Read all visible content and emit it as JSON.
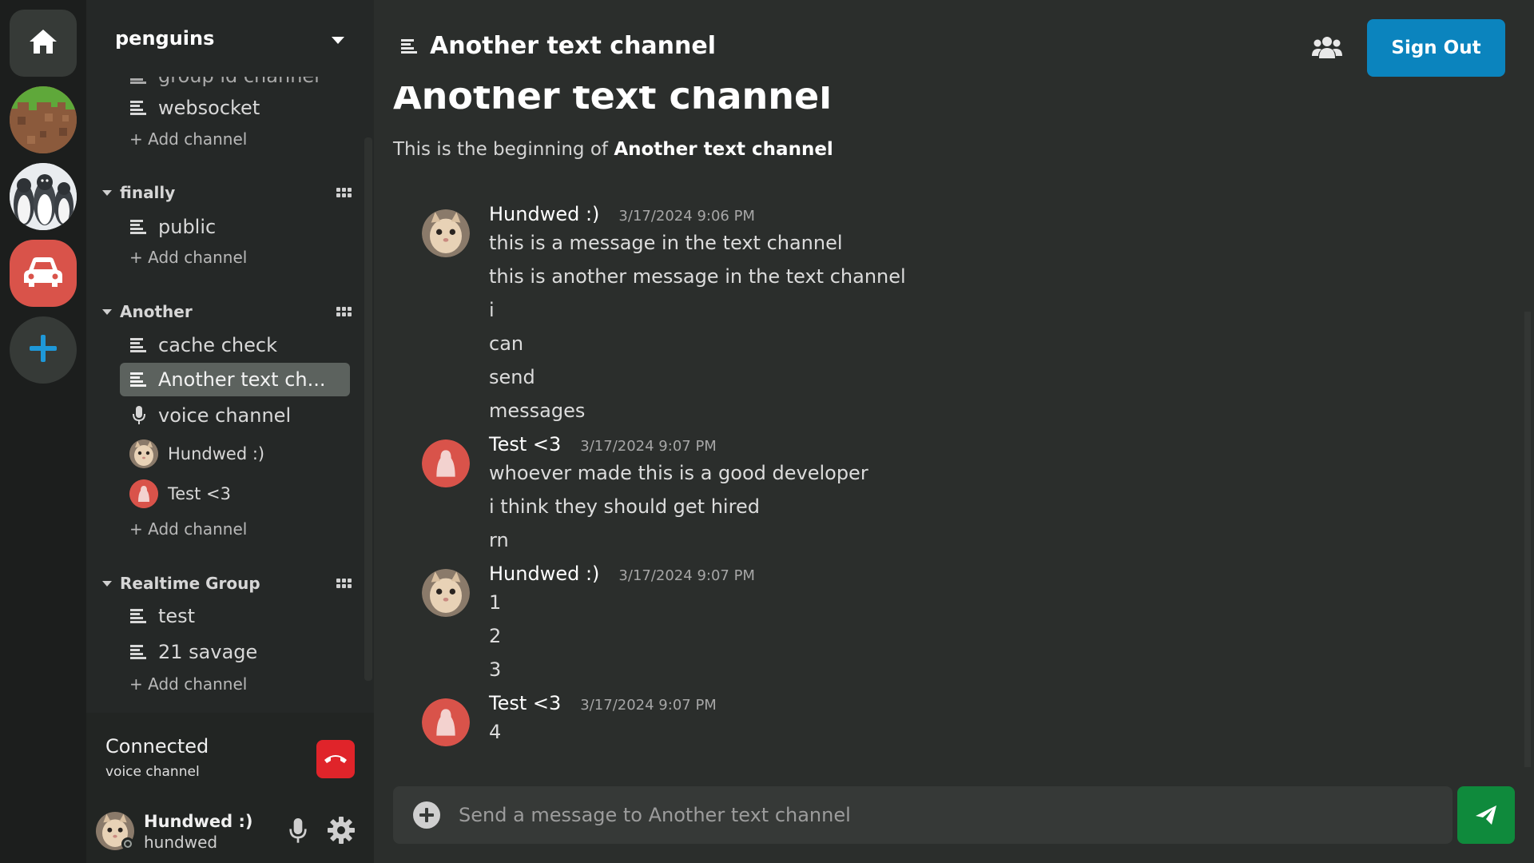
{
  "server": {
    "name": "penguins"
  },
  "sidebar": {
    "clipped_channel": "group id channel",
    "top_channels": [
      {
        "label": "websocket"
      }
    ],
    "add_channel_label": "+ Add channel",
    "categories": [
      {
        "name": "finally",
        "channels": [
          {
            "label": "public"
          }
        ]
      },
      {
        "name": "Another",
        "channels": [
          {
            "label": "cache check"
          },
          {
            "label": "Another text ch..."
          },
          {
            "label": "voice channel"
          }
        ],
        "voice_users": [
          {
            "name": "Hundwed :)"
          },
          {
            "name": "Test <3"
          }
        ]
      },
      {
        "name": "Realtime Group",
        "channels": [
          {
            "label": "test"
          },
          {
            "label": "21 savage"
          }
        ]
      }
    ]
  },
  "voice": {
    "status": "Connected",
    "channel": "voice channel"
  },
  "user": {
    "display_name": "Hundwed :)",
    "username": "hundwed"
  },
  "header": {
    "title": "Another text channel",
    "sign_out": "Sign Out"
  },
  "intro": {
    "title": "Another text channel",
    "prefix": "This is the beginning of ",
    "channel": "Another text channel"
  },
  "messages": [
    {
      "author": "Hundwed :)",
      "time": "3/17/2024 9:06 PM",
      "avatar": "cat",
      "lines": [
        "this is a message in the text channel",
        "this is another message in the text channel",
        "i",
        "can",
        "send",
        "messages"
      ]
    },
    {
      "author": "Test <3",
      "time": "3/17/2024 9:07 PM",
      "avatar": "default",
      "lines": [
        "whoever made this is a good developer",
        "i think they should get hired",
        "rn"
      ]
    },
    {
      "author": "Hundwed :)",
      "time": "3/17/2024 9:07 PM",
      "avatar": "cat",
      "lines": [
        "1",
        "2",
        "3"
      ]
    },
    {
      "author": "Test <3",
      "time": "3/17/2024 9:07 PM",
      "avatar": "default",
      "lines": [
        "4"
      ]
    }
  ],
  "composer": {
    "placeholder": "Send a message to Another text channel"
  },
  "colors": {
    "accent": "#0b84be",
    "send": "#0f8a3c",
    "hangup": "#e0242a",
    "default_avatar": "#d9534a"
  }
}
